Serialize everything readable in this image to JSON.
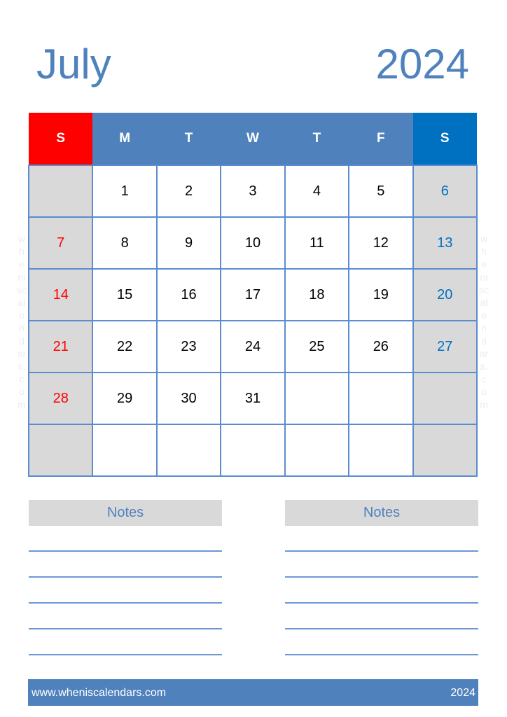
{
  "header": {
    "month": "July",
    "year": "2024"
  },
  "weekdays": [
    "S",
    "M",
    "T",
    "W",
    "T",
    "F",
    "S"
  ],
  "weeks": [
    [
      "",
      "1",
      "2",
      "3",
      "4",
      "5",
      "6"
    ],
    [
      "7",
      "8",
      "9",
      "10",
      "11",
      "12",
      "13"
    ],
    [
      "14",
      "15",
      "16",
      "17",
      "18",
      "19",
      "20"
    ],
    [
      "21",
      "22",
      "23",
      "24",
      "25",
      "26",
      "27"
    ],
    [
      "28",
      "29",
      "30",
      "31",
      "",
      "",
      ""
    ],
    [
      "",
      "",
      "",
      "",
      "",
      "",
      ""
    ]
  ],
  "watermark": "wheniscalendars.com",
  "notes": [
    {
      "title": "Notes"
    },
    {
      "title": "Notes"
    }
  ],
  "footer": {
    "website": "www.wheniscalendars.com",
    "year": "2024"
  },
  "colors": {
    "accent": "#4f81bd",
    "sunday": "#ff0000",
    "saturday": "#0070c0",
    "weekend_cell": "#d9d9d9"
  }
}
